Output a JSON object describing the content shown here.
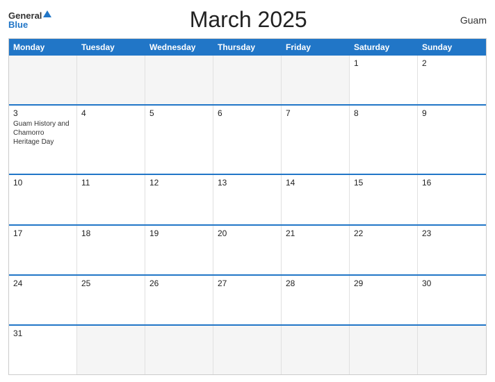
{
  "header": {
    "title": "March 2025",
    "region": "Guam",
    "logo_general": "General",
    "logo_blue": "Blue"
  },
  "calendar": {
    "days_of_week": [
      "Monday",
      "Tuesday",
      "Wednesday",
      "Thursday",
      "Friday",
      "Saturday",
      "Sunday"
    ],
    "weeks": [
      [
        {
          "day": "",
          "empty": true
        },
        {
          "day": "",
          "empty": true
        },
        {
          "day": "",
          "empty": true
        },
        {
          "day": "",
          "empty": true
        },
        {
          "day": "",
          "empty": true
        },
        {
          "day": "1",
          "empty": false,
          "event": ""
        },
        {
          "day": "2",
          "empty": false,
          "event": ""
        }
      ],
      [
        {
          "day": "3",
          "empty": false,
          "event": "Guam History and Chamorro Heritage Day"
        },
        {
          "day": "4",
          "empty": false,
          "event": ""
        },
        {
          "day": "5",
          "empty": false,
          "event": ""
        },
        {
          "day": "6",
          "empty": false,
          "event": ""
        },
        {
          "day": "7",
          "empty": false,
          "event": ""
        },
        {
          "day": "8",
          "empty": false,
          "event": ""
        },
        {
          "day": "9",
          "empty": false,
          "event": ""
        }
      ],
      [
        {
          "day": "10",
          "empty": false,
          "event": ""
        },
        {
          "day": "11",
          "empty": false,
          "event": ""
        },
        {
          "day": "12",
          "empty": false,
          "event": ""
        },
        {
          "day": "13",
          "empty": false,
          "event": ""
        },
        {
          "day": "14",
          "empty": false,
          "event": ""
        },
        {
          "day": "15",
          "empty": false,
          "event": ""
        },
        {
          "day": "16",
          "empty": false,
          "event": ""
        }
      ],
      [
        {
          "day": "17",
          "empty": false,
          "event": ""
        },
        {
          "day": "18",
          "empty": false,
          "event": ""
        },
        {
          "day": "19",
          "empty": false,
          "event": ""
        },
        {
          "day": "20",
          "empty": false,
          "event": ""
        },
        {
          "day": "21",
          "empty": false,
          "event": ""
        },
        {
          "day": "22",
          "empty": false,
          "event": ""
        },
        {
          "day": "23",
          "empty": false,
          "event": ""
        }
      ],
      [
        {
          "day": "24",
          "empty": false,
          "event": ""
        },
        {
          "day": "25",
          "empty": false,
          "event": ""
        },
        {
          "day": "26",
          "empty": false,
          "event": ""
        },
        {
          "day": "27",
          "empty": false,
          "event": ""
        },
        {
          "day": "28",
          "empty": false,
          "event": ""
        },
        {
          "day": "29",
          "empty": false,
          "event": ""
        },
        {
          "day": "30",
          "empty": false,
          "event": ""
        }
      ],
      [
        {
          "day": "31",
          "empty": false,
          "event": ""
        },
        {
          "day": "",
          "empty": true
        },
        {
          "day": "",
          "empty": true
        },
        {
          "day": "",
          "empty": true
        },
        {
          "day": "",
          "empty": true
        },
        {
          "day": "",
          "empty": true
        },
        {
          "day": "",
          "empty": true
        }
      ]
    ]
  }
}
